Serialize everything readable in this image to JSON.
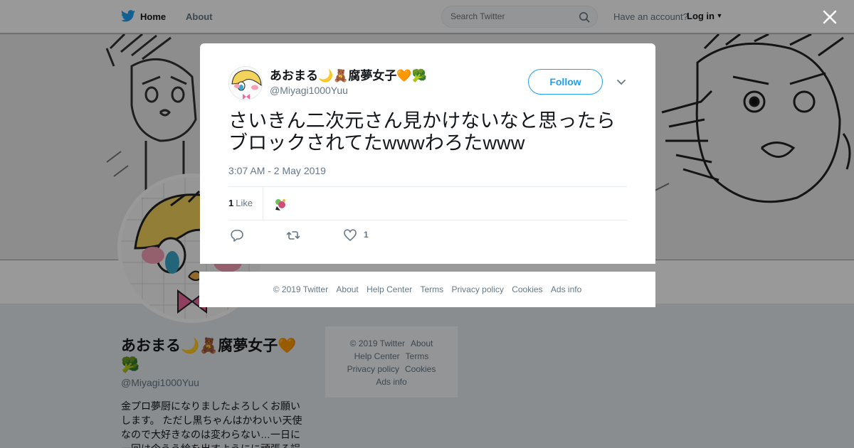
{
  "header": {
    "home_label": "Home",
    "about_label": "About",
    "search_placeholder": "Search Twitter",
    "have_account": "Have an account?",
    "login_label": "Log in"
  },
  "profile": {
    "name": "あおまる🌙🧸腐夢女子🧡🥦",
    "handle": "@Miyagi1000Yuu",
    "bio": "金プロ夢厨になりましたよろしくお願いします。 ただし黒ちゃんはかわいい天使なので大好きなのは変わらない…一日に一回は今うう絵を出すようにに頑張る誤字"
  },
  "side_footer": {
    "links": [
      "© 2019 Twitter",
      "About",
      "Help Center",
      "Terms",
      "Privacy policy",
      "Cookies",
      "Ads info"
    ]
  },
  "tweet": {
    "author_name": "あおまる🌙🧸腐夢女子🧡🥦",
    "author_handle": "@Miyagi1000Yuu",
    "follow_label": "Follow",
    "text": "さいきん二次元さん見かけないなと思ったらブロックされてたwwwわろたwww",
    "timestamp": "3:07 AM - 2 May 2019",
    "like_count": "1",
    "like_label": "Like",
    "action_like_count": "1"
  },
  "modal_footer": {
    "links": [
      "© 2019 Twitter",
      "About",
      "Help Center",
      "Terms",
      "Privacy policy",
      "Cookies",
      "Ads info"
    ]
  },
  "icons": {
    "logo": "twitter-bird-icon",
    "search": "search-icon",
    "close": "close-icon",
    "dropdown": "chevron-down-icon",
    "reply": "reply-icon",
    "retweet": "retweet-icon",
    "like": "heart-icon"
  },
  "colors": {
    "accent": "#1da1f2",
    "text": "#14171a",
    "secondary": "#657786"
  }
}
